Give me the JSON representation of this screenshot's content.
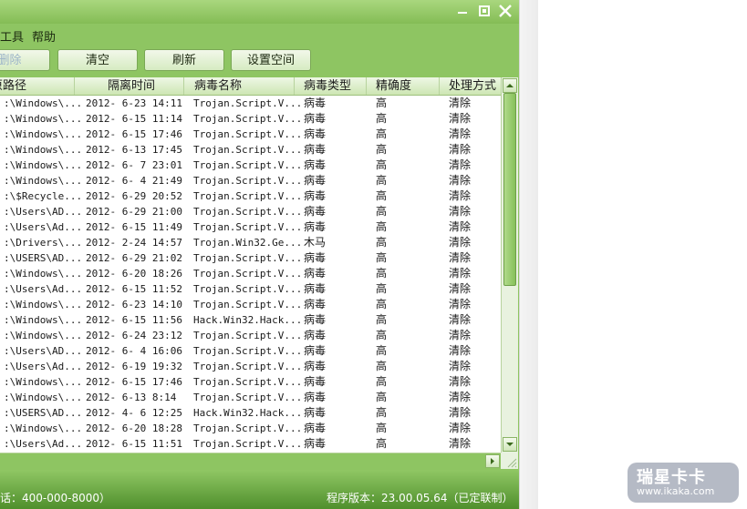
{
  "window": {
    "controls": {
      "minimize_icon": "minimize-icon",
      "maximize_icon": "maximize-icon",
      "close_icon": "close-icon"
    }
  },
  "menu": [
    "工具",
    "帮助"
  ],
  "toolbar": {
    "delete_label": "删除",
    "clear_label": "清空",
    "refresh_label": "刷新",
    "settings_label": "设置空间"
  },
  "table": {
    "columns": [
      "原路径",
      "隔离时间",
      "病毒名称",
      "病毒类型",
      "精确度",
      "处理方式"
    ],
    "rows": [
      [
        ":\\Windows\\...",
        "2012- 6-23 14:11",
        "Trojan.Script.V...",
        "病毒",
        "高",
        "清除"
      ],
      [
        ":\\Windows\\...",
        "2012- 6-15 11:14",
        "Trojan.Script.V...",
        "病毒",
        "高",
        "清除"
      ],
      [
        ":\\Windows\\...",
        "2012- 6-15 17:46",
        "Trojan.Script.V...",
        "病毒",
        "高",
        "清除"
      ],
      [
        ":\\Windows\\...",
        "2012- 6-13 17:45",
        "Trojan.Script.V...",
        "病毒",
        "高",
        "清除"
      ],
      [
        ":\\Windows\\...",
        "2012- 6- 7 23:01",
        "Trojan.Script.V...",
        "病毒",
        "高",
        "清除"
      ],
      [
        ":\\Windows\\...",
        "2012- 6- 4 21:49",
        "Trojan.Script.V...",
        "病毒",
        "高",
        "清除"
      ],
      [
        ":\\$Recycle...",
        "2012- 6-29 20:52",
        "Trojan.Script.V...",
        "病毒",
        "高",
        "清除"
      ],
      [
        ":\\Users\\AD...",
        "2012- 6-29 21:00",
        "Trojan.Script.V...",
        "病毒",
        "高",
        "清除"
      ],
      [
        ":\\Users\\Ad...",
        "2012- 6-15 11:49",
        "Trojan.Script.V...",
        "病毒",
        "高",
        "清除"
      ],
      [
        ":\\Drivers\\...",
        "2012- 2-24 14:57",
        "Trojan.Win32.Ge...",
        "木马",
        "高",
        "清除"
      ],
      [
        ":\\USERS\\AD...",
        "2012- 6-29 21:02",
        "Trojan.Script.V...",
        "病毒",
        "高",
        "清除"
      ],
      [
        ":\\Windows\\...",
        "2012- 6-20 18:26",
        "Trojan.Script.V...",
        "病毒",
        "高",
        "清除"
      ],
      [
        ":\\Users\\Ad...",
        "2012- 6-15 11:52",
        "Trojan.Script.V...",
        "病毒",
        "高",
        "清除"
      ],
      [
        ":\\Windows\\...",
        "2012- 6-23 14:10",
        "Trojan.Script.V...",
        "病毒",
        "高",
        "清除"
      ],
      [
        ":\\Windows\\...",
        "2012- 6-15 11:56",
        "Hack.Win32.Hack...",
        "病毒",
        "高",
        "清除"
      ],
      [
        ":\\Windows\\...",
        "2012- 6-24 23:12",
        "Trojan.Script.V...",
        "病毒",
        "高",
        "清除"
      ],
      [
        ":\\Users\\AD...",
        "2012- 6- 4 16:06",
        "Trojan.Script.V...",
        "病毒",
        "高",
        "清除"
      ],
      [
        ":\\Users\\Ad...",
        "2012- 6-19 19:32",
        "Trojan.Script.V...",
        "病毒",
        "高",
        "清除"
      ],
      [
        ":\\Windows\\...",
        "2012- 6-15 17:46",
        "Trojan.Script.V...",
        "病毒",
        "高",
        "清除"
      ],
      [
        ":\\Windows\\...",
        "2012- 6-13  8:14",
        "Trojan.Script.V...",
        "病毒",
        "高",
        "清除"
      ],
      [
        ":\\USERS\\AD...",
        "2012- 4- 6 12:25",
        "Hack.Win32.Hack...",
        "病毒",
        "高",
        "清除"
      ],
      [
        ":\\Windows\\...",
        "2012- 6-20 18:28",
        "Trojan.Script.V...",
        "病毒",
        "高",
        "清除"
      ],
      [
        ":\\Users\\Ad...",
        "2012- 6-15 11:51",
        "Trojan.Script.V...",
        "病毒",
        "高",
        "清除"
      ]
    ]
  },
  "status": {
    "left": "话：400-000-8000）",
    "right": "程序版本：23.00.05.64（已定联制）"
  },
  "watermark": {
    "title": "瑞星卡卡",
    "url": "www.ikaka.com"
  }
}
